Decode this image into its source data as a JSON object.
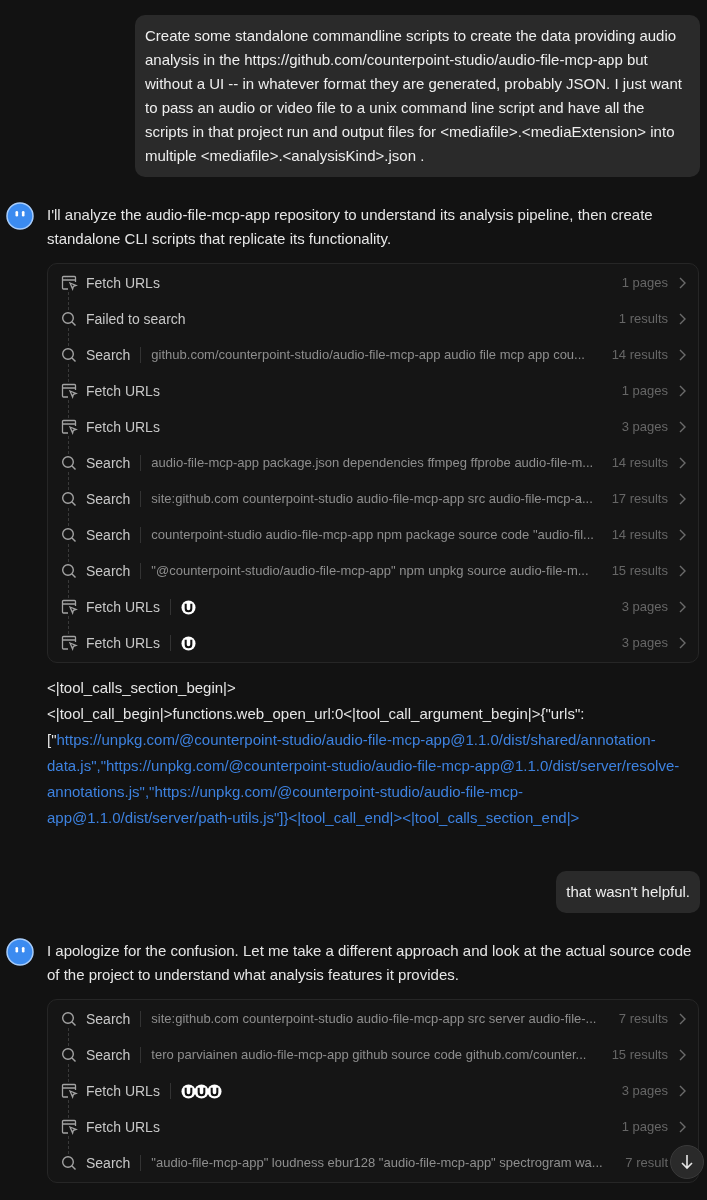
{
  "messages": [
    {
      "kind": "user",
      "text": "Create some standalone commandline scripts to create the data providing audio analysis in the https://github.com/counterpoint-studio/audio-file-mcp-app but without a UI -- in whatever format they are generated, probably JSON.  I just want to pass an audio or video file to a unix command line script and have all the scripts in that project run and output files for <mediafile>.<mediaExtension> into multiple <mediafile>.<analysisKind>.json ."
    },
    {
      "kind": "assistant",
      "text": "I'll analyze the audio-file-mcp-app repository to understand its analysis pipeline, then create standalone CLI scripts that replicate its functionality.",
      "tools": [
        {
          "kind": "fetch",
          "label": "Fetch URLs",
          "count": "1 pages"
        },
        {
          "kind": "search",
          "label": "Failed to search",
          "count": "1 results"
        },
        {
          "kind": "search",
          "label": "Search",
          "query": "github.com/counterpoint-studio/audio-file-mcp-app audio file mcp app cou...",
          "count": "14 results"
        },
        {
          "kind": "fetch",
          "label": "Fetch URLs",
          "count": "1 pages"
        },
        {
          "kind": "fetch",
          "label": "Fetch URLs",
          "count": "3 pages"
        },
        {
          "kind": "search",
          "label": "Search",
          "query": "audio-file-mcp-app package.json dependencies ffmpeg ffprobe audio-file-m...",
          "count": "14 results"
        },
        {
          "kind": "search",
          "label": "Search",
          "query": "site:github.com counterpoint-studio audio-file-mcp-app src audio-file-mcp-a...",
          "count": "17 results"
        },
        {
          "kind": "search",
          "label": "Search",
          "query": "counterpoint-studio audio-file-mcp-app npm package source code \"audio-fil...",
          "count": "14 results"
        },
        {
          "kind": "search",
          "label": "Search",
          "query": "\"@counterpoint-studio/audio-file-mcp-app\" npm unpkg source audio-file-m...",
          "count": "15 results"
        },
        {
          "kind": "fetch",
          "label": "Fetch URLs",
          "sources": [
            {
              "kind": "favicon"
            }
          ],
          "count": "3 pages"
        },
        {
          "kind": "fetch",
          "label": "Fetch URLs",
          "sources": [
            {
              "kind": "favicon"
            }
          ],
          "count": "3 pages"
        }
      ]
    },
    {
      "kind": "raw",
      "text": "<|tool_calls_section_begin|>\n<|tool_call_begin|>functions.web_open_url:0<|tool_call_argument_begin|>{\"urls\":[\"",
      "link_text": "https://unpkg.com/@counterpoint-studio/audio-file-mcp-app@1.1.0/dist/shared/annotation-data.js\",\"https://unpkg.com/@counterpoint-studio/audio-file-mcp-app@1.1.0/dist/server/resolve-annotations.js\",\"https://unpkg.com/@counterpoint-studio/audio-file-mcp-app@1.1.0/dist/server/path-utils.js\"]}<|tool_call_end|><|tool_calls_section_end|>"
    },
    {
      "kind": "user",
      "text": "that wasn't helpful."
    },
    {
      "kind": "assistant",
      "text": "I apologize for the confusion. Let me take a different approach and look at the actual source code of the project to understand what analysis features it provides.",
      "tools": [
        {
          "kind": "search",
          "label": "Search",
          "query": "site:github.com counterpoint-studio audio-file-mcp-app src server audio-file-...",
          "count": "7 results"
        },
        {
          "kind": "search",
          "label": "Search",
          "query": "tero parviainen audio-file-mcp-app github source code github.com/counter...",
          "count": "15 results"
        },
        {
          "kind": "fetch",
          "label": "Fetch URLs",
          "sources": [
            {
              "kind": "favicon"
            },
            {
              "kind": "favicon"
            },
            {
              "kind": "favicon"
            }
          ],
          "count": "3 pages"
        },
        {
          "kind": "fetch",
          "label": "Fetch URLs",
          "count": "1 pages"
        },
        {
          "kind": "search",
          "label": "Search",
          "query": "\"audio-file-mcp-app\" loudness ebur128 \"audio-file-mcp-app\" spectrogram wa...",
          "count": "7 result"
        }
      ]
    }
  ],
  "scroll_button": {
    "kind": "down"
  }
}
